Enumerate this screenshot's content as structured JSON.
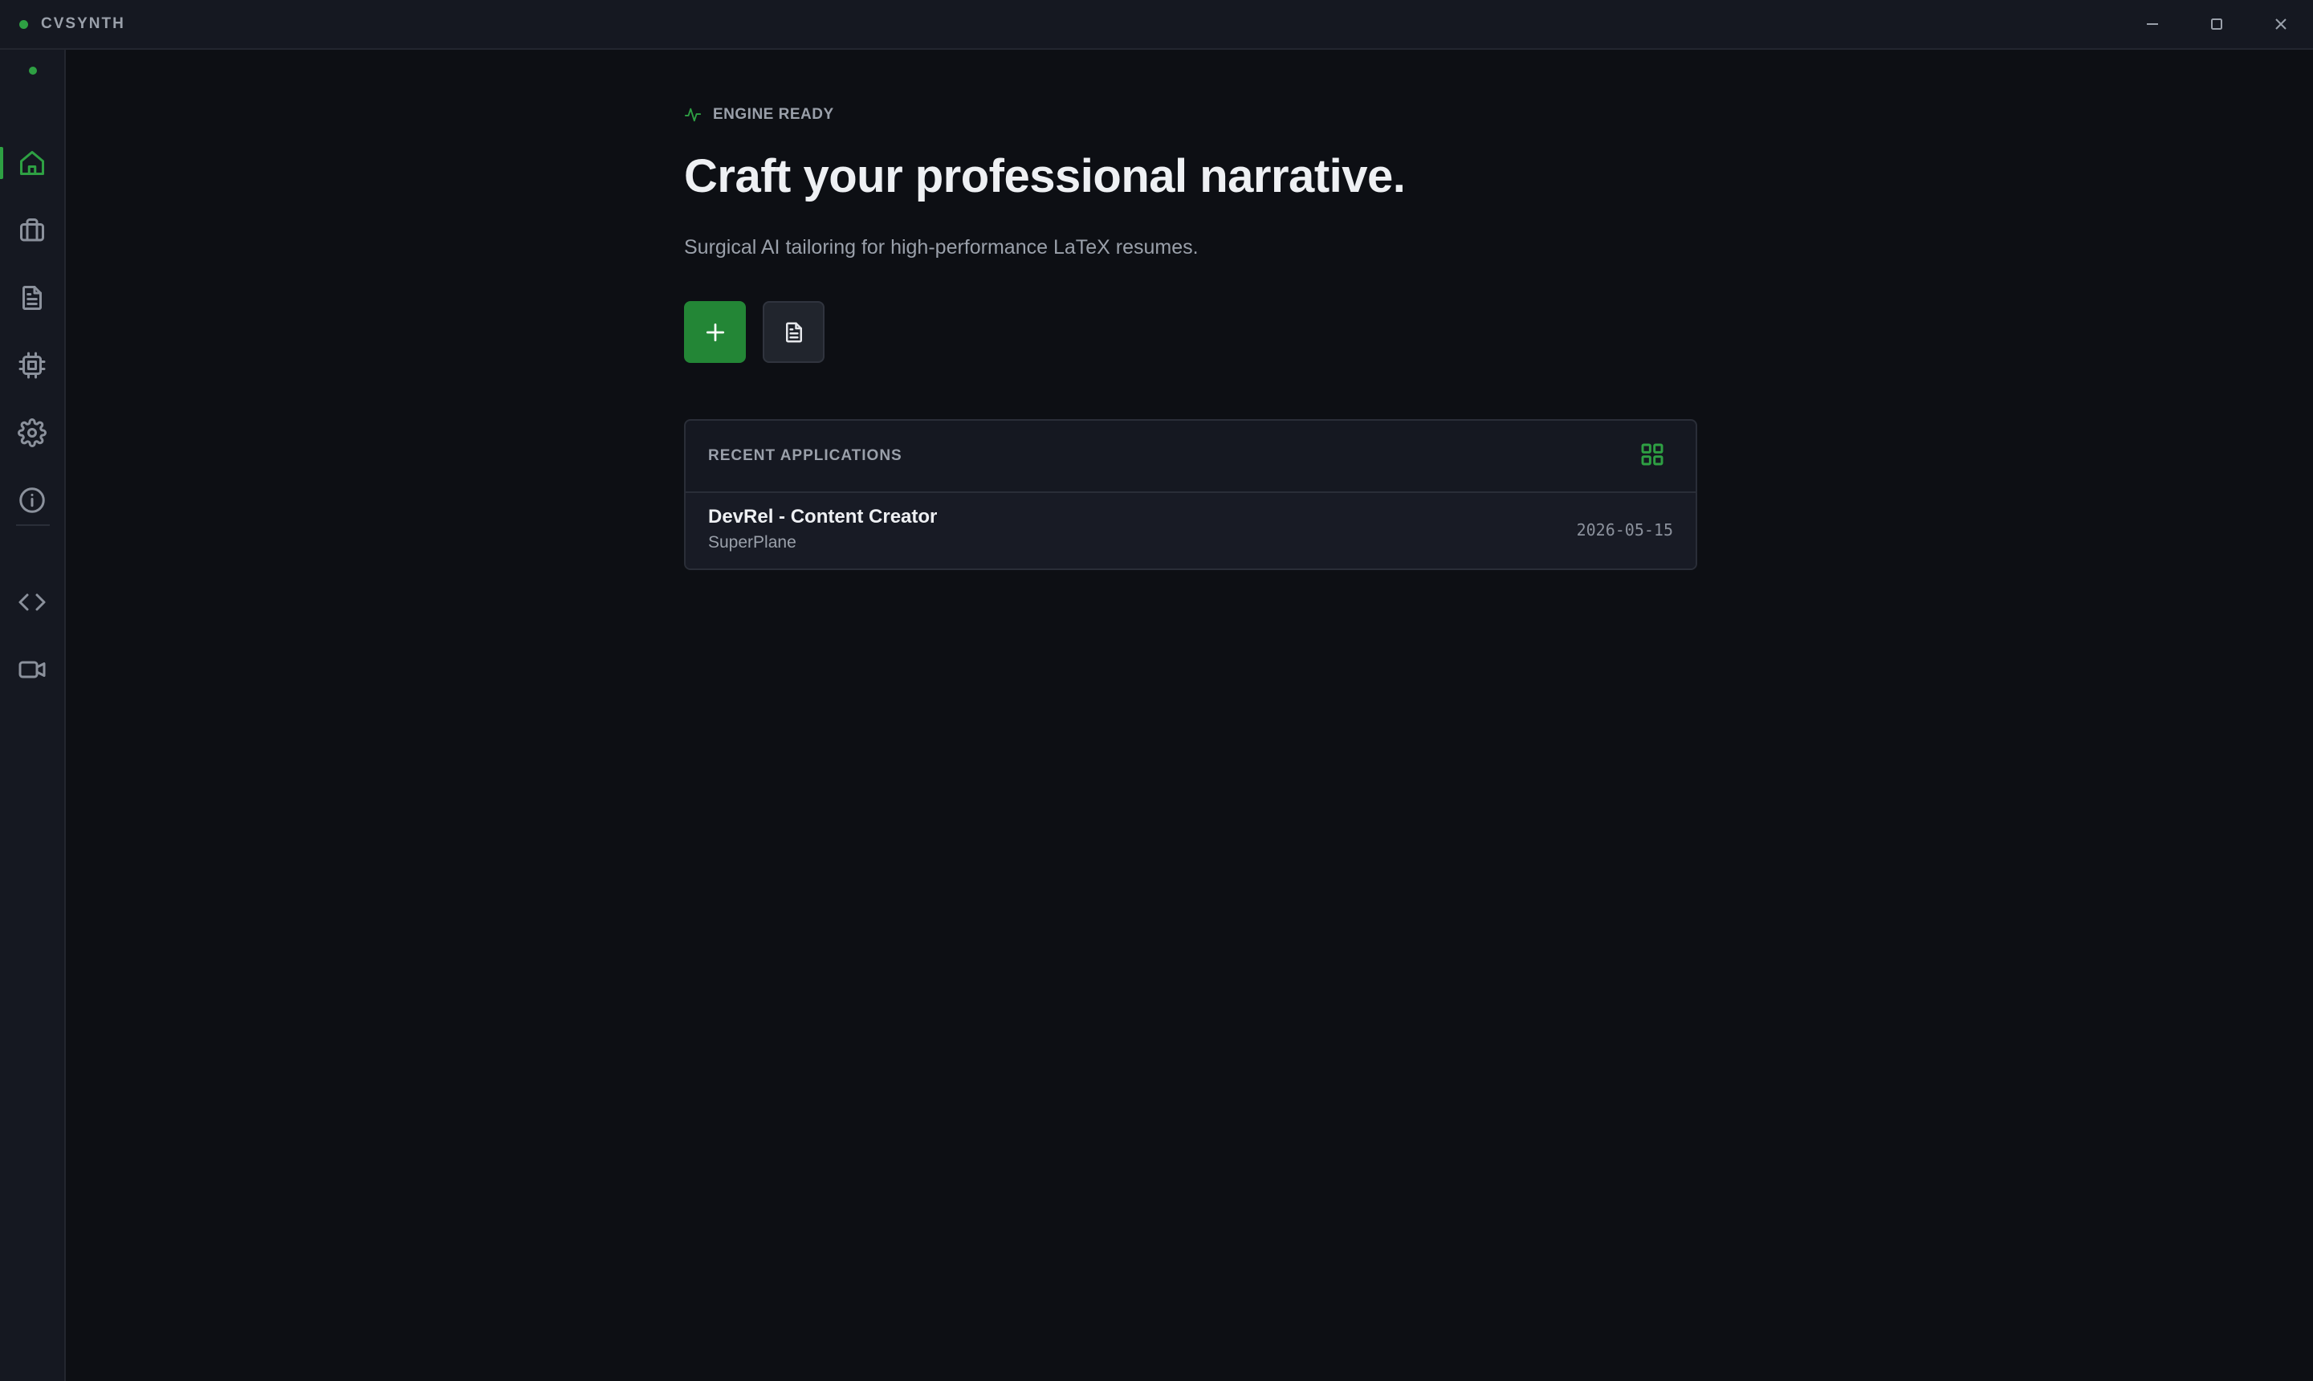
{
  "window": {
    "title": "CVSYNTH",
    "accent_color": "#2ea043",
    "controls": [
      "minimize-icon",
      "maximize-icon",
      "close-icon"
    ]
  },
  "sidebar": {
    "items": [
      {
        "id": "home",
        "icon": "home-icon",
        "active": true
      },
      {
        "id": "jobs",
        "icon": "briefcase-icon",
        "active": false
      },
      {
        "id": "documents",
        "icon": "document-icon",
        "active": false
      },
      {
        "id": "engine",
        "icon": "cpu-icon",
        "active": false
      },
      {
        "id": "settings",
        "icon": "gear-icon",
        "active": false
      },
      {
        "id": "about",
        "icon": "info-icon",
        "active": false
      },
      {
        "id": "developer",
        "icon": "code-icon",
        "active": false
      },
      {
        "id": "video",
        "icon": "video-icon",
        "active": false
      }
    ]
  },
  "main": {
    "status": "ENGINE READY",
    "headline": "Craft your professional narrative.",
    "subtitle": "Surgical AI tailoring for high-performance LaTeX resumes.",
    "actions": {
      "primary_icon": "plus-icon",
      "secondary_icon": "document-icon"
    },
    "recent": {
      "title": "RECENT APPLICATIONS",
      "view_icon": "grid-icon",
      "rows": [
        {
          "title": "DevRel - Content Creator",
          "company": "SuperPlane",
          "date": "2026-05-15"
        }
      ]
    }
  }
}
